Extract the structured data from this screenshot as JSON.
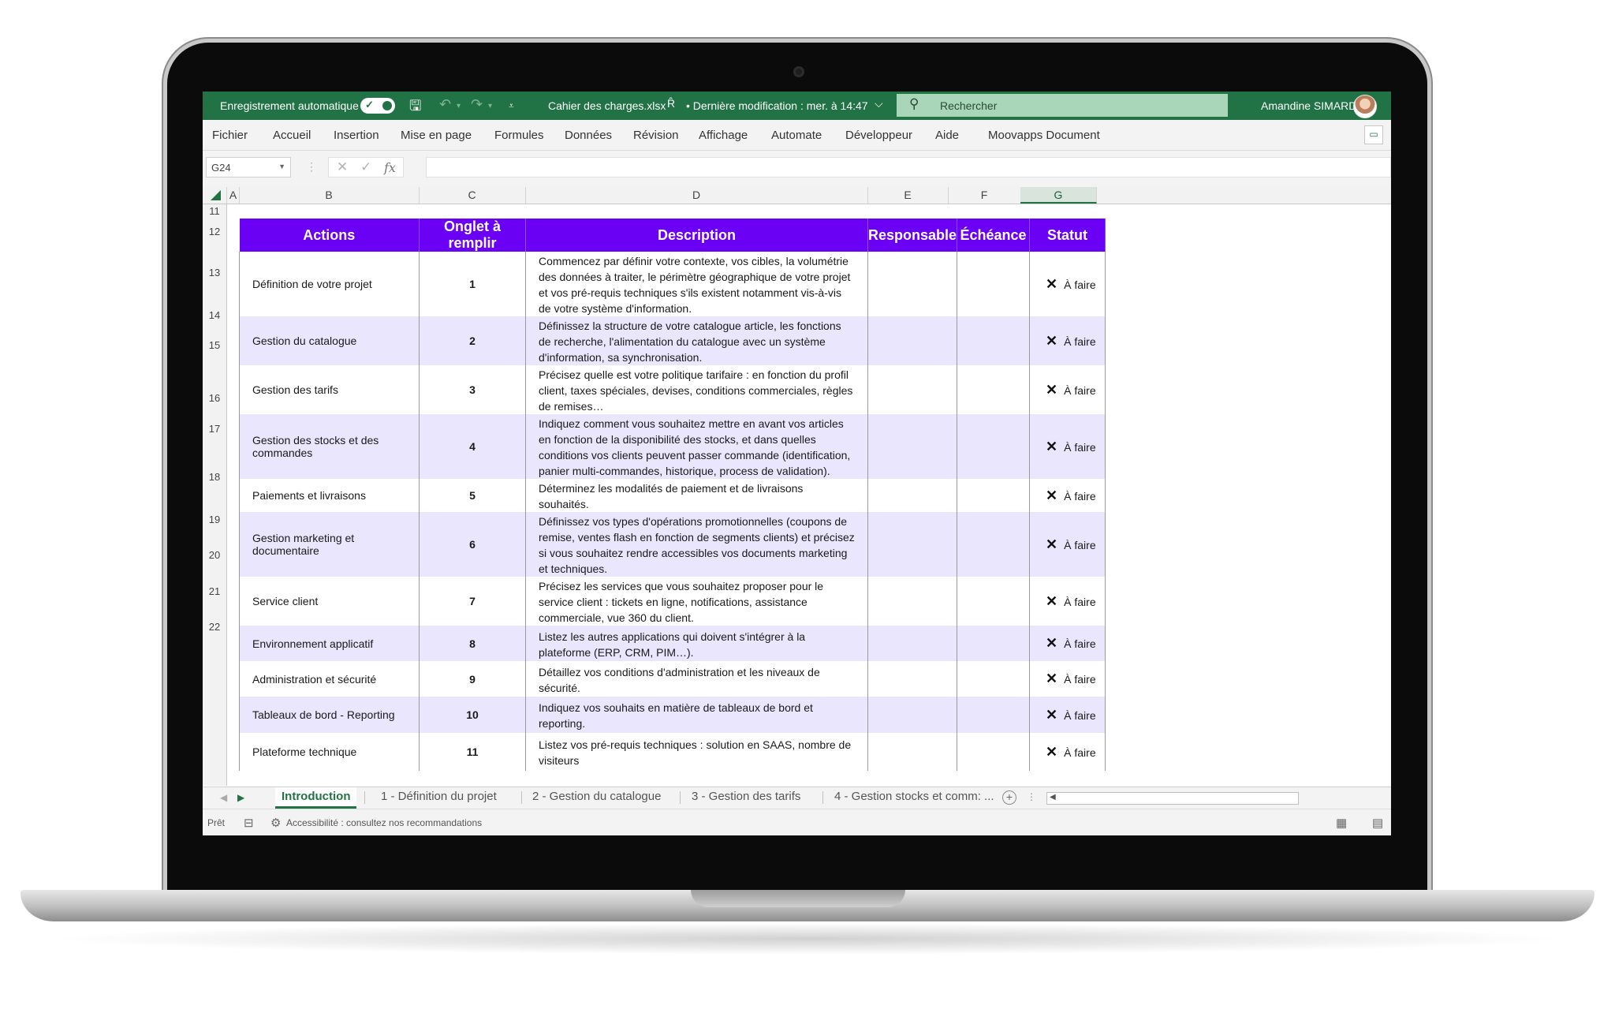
{
  "titlebar": {
    "autosave_label": "Enregistrement automatique",
    "autosave_check": "✓",
    "file_name": "Cahier des charges.xlsx",
    "share_icon": "R̂",
    "last_modified": "• Dernière modification : mer. à 14:47",
    "chevron": "⌵",
    "search_placeholder": "Rechercher",
    "user_name": "Amandine SIMARD"
  },
  "menu": [
    "Fichier",
    "Accueil",
    "Insertion",
    "Mise en page",
    "Formules",
    "Données",
    "Révision",
    "Affichage",
    "Automate",
    "Développeur",
    "Aide",
    "Moovapps Document"
  ],
  "formula_bar": {
    "name_box": "G24",
    "formula_value": ""
  },
  "columns": [
    "A",
    "B",
    "C",
    "D",
    "E",
    "F",
    "G"
  ],
  "row_numbers": [
    "11",
    "12",
    "13",
    "14",
    "15",
    "16",
    "17",
    "18",
    "19",
    "20",
    "21",
    "22"
  ],
  "table": {
    "headers": {
      "actions": "Actions",
      "onglet": "Onglet à remplir",
      "description": "Description",
      "responsable": "Responsable",
      "echeance": "Échéance",
      "statut": "Statut"
    },
    "rows": [
      {
        "action": "Définition de votre projet",
        "onglet": "1",
        "description": "Commencez par définir votre contexte, vos cibles, la volumétrie des données à traiter, le périmètre géographique de votre projet et vos pré-requis techniques s'ils existent notamment vis-à-vis de votre système d'information.",
        "responsable": "",
        "echeance": "",
        "statut": "À faire"
      },
      {
        "action": "Gestion du catalogue",
        "onglet": "2",
        "description": "Définissez la structure de votre catalogue article, les fonctions de recherche, l'alimentation du catalogue avec un système d'information, sa synchronisation.",
        "responsable": "",
        "echeance": "",
        "statut": "À faire"
      },
      {
        "action": "Gestion des tarifs",
        "onglet": "3",
        "description": "Précisez quelle est votre politique tarifaire : en fonction du profil client, taxes spéciales, devises, conditions commerciales, règles de remises…",
        "responsable": "",
        "echeance": "",
        "statut": "À faire"
      },
      {
        "action": "Gestion des stocks et des commandes",
        "onglet": "4",
        "description": "Indiquez comment vous souhaitez mettre en avant vos articles en fonction de la disponibilité des stocks, et dans quelles conditions vos clients peuvent passer commande (identification, panier multi-commandes, historique, process de validation).",
        "responsable": "",
        "echeance": "",
        "statut": "À faire"
      },
      {
        "action": "Paiements et livraisons",
        "onglet": "5",
        "description": "Déterminez les modalités de paiement et de livraisons souhaités.",
        "responsable": "",
        "echeance": "",
        "statut": "À faire"
      },
      {
        "action": "Gestion marketing et documentaire",
        "onglet": "6",
        "description": "Définissez vos types d'opérations promotionnelles (coupons de remise, ventes flash en fonction de segments clients) et précisez si vous souhaitez rendre accessibles vos documents marketing et techniques.",
        "responsable": "",
        "echeance": "",
        "statut": "À faire"
      },
      {
        "action": "Service client",
        "onglet": "7",
        "description": "Précisez les services que vous souhaitez proposer pour le service client : tickets en ligne, notifications, assistance commerciale, vue 360 du client.",
        "responsable": "",
        "echeance": "",
        "statut": "À faire"
      },
      {
        "action": "Environnement applicatif",
        "onglet": "8",
        "description": "Listez les autres applications qui doivent s'intégrer à la plateforme (ERP, CRM, PIM…).",
        "responsable": "",
        "echeance": "",
        "statut": "À faire"
      },
      {
        "action": "Administration et sécurité",
        "onglet": "9",
        "description": "Détaillez vos conditions d'administration et les niveaux de sécurité.",
        "responsable": "",
        "echeance": "",
        "statut": "À faire"
      },
      {
        "action": "Tableaux de bord - Reporting",
        "onglet": "10",
        "description": "Indiquez vos souhaits en matière de tableaux de bord et reporting.",
        "responsable": "",
        "echeance": "",
        "statut": "À faire"
      },
      {
        "action": "Plateforme technique",
        "onglet": "11",
        "description": "Listez vos pré-requis techniques : solution en SAAS, nombre de visiteurs",
        "responsable": "",
        "echeance": "",
        "statut": "À faire"
      }
    ]
  },
  "sheet_tabs": [
    "Introduction",
    "1 - Définition du projet",
    "2 - Gestion du catalogue",
    "3 - Gestion des tarifs",
    "4 - Gestion stocks et comm: ..."
  ],
  "statusbar": {
    "ready": "Prêt",
    "accessibility": "Accessibilité : consultez nos recommandations"
  },
  "colors": {
    "excel_green": "#217346",
    "header_purple": "#6a00f4",
    "alt_row": "#e9e6fd"
  },
  "icons": {
    "status": "✕",
    "search": "search-icon",
    "save": "save-icon",
    "undo": "undo-icon",
    "redo": "redo-icon"
  }
}
